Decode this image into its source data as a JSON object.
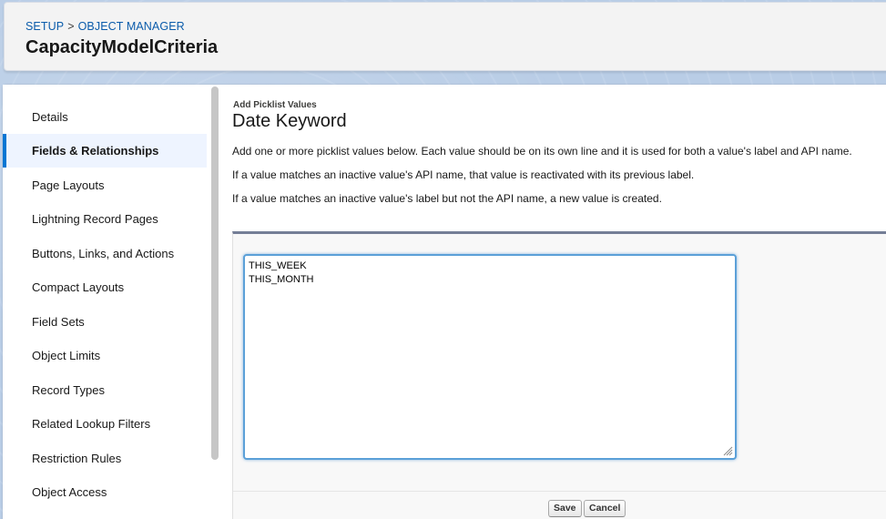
{
  "header": {
    "breadcrumb": {
      "setup": "SETUP",
      "separator": ">",
      "object_manager": "OBJECT MANAGER"
    },
    "title": "CapacityModelCriteria"
  },
  "sidebar": {
    "items": [
      {
        "label": "Details",
        "active": false
      },
      {
        "label": "Fields & Relationships",
        "active": true
      },
      {
        "label": "Page Layouts",
        "active": false
      },
      {
        "label": "Lightning Record Pages",
        "active": false
      },
      {
        "label": "Buttons, Links, and Actions",
        "active": false
      },
      {
        "label": "Compact Layouts",
        "active": false
      },
      {
        "label": "Field Sets",
        "active": false
      },
      {
        "label": "Object Limits",
        "active": false
      },
      {
        "label": "Record Types",
        "active": false
      },
      {
        "label": "Related Lookup Filters",
        "active": false
      },
      {
        "label": "Restriction Rules",
        "active": false
      },
      {
        "label": "Object Access",
        "active": false
      }
    ]
  },
  "main": {
    "subtitle": "Add Picklist Values",
    "field_title": "Date Keyword",
    "descriptions": [
      "Add one or more picklist values below. Each value should be on its own line and it is used for both a value's label and API name.",
      "If a value matches an inactive value's API name, that value is reactivated with its previous label.",
      "If a value matches an inactive value's label but not the API name, a new value is created."
    ],
    "textarea_value": "THIS_WEEK\nTHIS_MONTH",
    "save_label": "Save",
    "cancel_label": "Cancel"
  },
  "colors": {
    "accent": "#0176d3",
    "link": "#0b5cab",
    "active_item_bg": "#eef4ff",
    "panel_border": "#747e96",
    "focus_border": "#5ba0d8"
  }
}
